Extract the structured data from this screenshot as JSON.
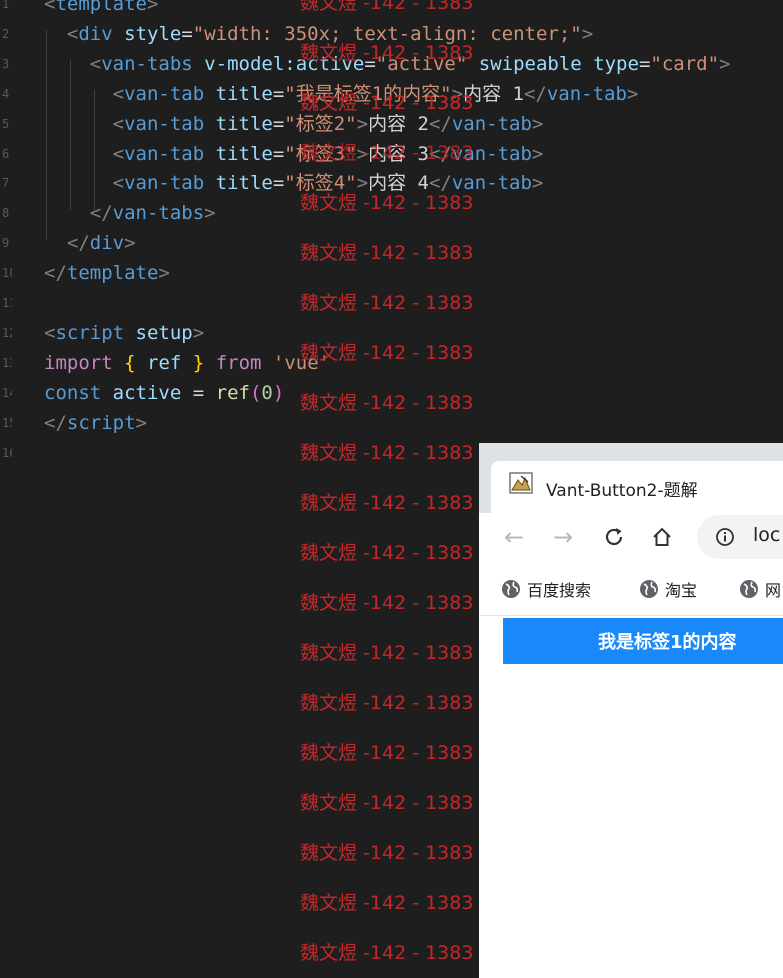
{
  "editor": {
    "line_numbers": [
      "1",
      "2",
      "3",
      "4",
      "5",
      "6",
      "7",
      "8",
      "9",
      "10",
      "11",
      "12",
      "13",
      "14",
      "15",
      "16"
    ],
    "lines": [
      [
        [
          "br",
          "<"
        ],
        [
          "tag",
          "template"
        ],
        [
          "br",
          ">"
        ]
      ],
      [
        [
          "txt",
          "  "
        ],
        [
          "br",
          "<"
        ],
        [
          "tag",
          "div"
        ],
        [
          "txt",
          " "
        ],
        [
          "attr",
          "style"
        ],
        [
          "txt",
          "="
        ],
        [
          "str",
          "\"width: 350x; text-align: center;\""
        ],
        [
          "br",
          ">"
        ]
      ],
      [
        [
          "txt",
          "    "
        ],
        [
          "br",
          "<"
        ],
        [
          "tag",
          "van-tabs"
        ],
        [
          "txt",
          " "
        ],
        [
          "attr",
          "v-model:active"
        ],
        [
          "txt",
          "="
        ],
        [
          "str",
          "\"active\""
        ],
        [
          "txt",
          " "
        ],
        [
          "attr",
          "swipeable"
        ],
        [
          "txt",
          " "
        ],
        [
          "attr",
          "type"
        ],
        [
          "txt",
          "="
        ],
        [
          "str",
          "\"card\""
        ],
        [
          "br",
          ">"
        ]
      ],
      [
        [
          "txt",
          "      "
        ],
        [
          "br",
          "<"
        ],
        [
          "tag",
          "van-tab"
        ],
        [
          "txt",
          " "
        ],
        [
          "attr",
          "title"
        ],
        [
          "txt",
          "="
        ],
        [
          "str",
          "\"我是标签1的内容\""
        ],
        [
          "br",
          ">"
        ],
        [
          "txt",
          "内容 1"
        ],
        [
          "br",
          "</"
        ],
        [
          "tag",
          "van-tab"
        ],
        [
          "br",
          ">"
        ]
      ],
      [
        [
          "txt",
          "      "
        ],
        [
          "br",
          "<"
        ],
        [
          "tag",
          "van-tab"
        ],
        [
          "txt",
          " "
        ],
        [
          "attr",
          "title"
        ],
        [
          "txt",
          "="
        ],
        [
          "str",
          "\"标签2\""
        ],
        [
          "br",
          ">"
        ],
        [
          "txt",
          "内容 2"
        ],
        [
          "br",
          "</"
        ],
        [
          "tag",
          "van-tab"
        ],
        [
          "br",
          ">"
        ]
      ],
      [
        [
          "txt",
          "      "
        ],
        [
          "br",
          "<"
        ],
        [
          "tag",
          "van-tab"
        ],
        [
          "txt",
          " "
        ],
        [
          "attr",
          "title"
        ],
        [
          "txt",
          "="
        ],
        [
          "str",
          "\"标签3\""
        ],
        [
          "br",
          ">"
        ],
        [
          "txt",
          "内容 3"
        ],
        [
          "br",
          "</"
        ],
        [
          "tag",
          "van-tab"
        ],
        [
          "br",
          ">"
        ]
      ],
      [
        [
          "txt",
          "      "
        ],
        [
          "br",
          "<"
        ],
        [
          "tag",
          "van-tab"
        ],
        [
          "txt",
          " "
        ],
        [
          "attr",
          "title"
        ],
        [
          "txt",
          "="
        ],
        [
          "str",
          "\"标签4\""
        ],
        [
          "br",
          ">"
        ],
        [
          "txt",
          "内容 4"
        ],
        [
          "br",
          "</"
        ],
        [
          "tag",
          "van-tab"
        ],
        [
          "br",
          ">"
        ]
      ],
      [
        [
          "txt",
          "    "
        ],
        [
          "br",
          "</"
        ],
        [
          "tag",
          "van-tabs"
        ],
        [
          "br",
          ">"
        ]
      ],
      [
        [
          "txt",
          "  "
        ],
        [
          "br",
          "</"
        ],
        [
          "tag",
          "div"
        ],
        [
          "br",
          ">"
        ]
      ],
      [
        [
          "br",
          "</"
        ],
        [
          "tag",
          "template"
        ],
        [
          "br",
          ">"
        ]
      ],
      [],
      [
        [
          "br",
          "<"
        ],
        [
          "tag",
          "script"
        ],
        [
          "txt",
          " "
        ],
        [
          "attr",
          "setup"
        ],
        [
          "br",
          ">"
        ]
      ],
      [
        [
          "kw",
          "import"
        ],
        [
          "txt",
          " "
        ],
        [
          "brace",
          "{"
        ],
        [
          "txt",
          " "
        ],
        [
          "var",
          "ref"
        ],
        [
          "txt",
          " "
        ],
        [
          "brace",
          "}"
        ],
        [
          "txt",
          " "
        ],
        [
          "kw",
          "from"
        ],
        [
          "txt",
          " "
        ],
        [
          "str",
          "'vue'"
        ]
      ],
      [
        [
          "kw2",
          "const"
        ],
        [
          "txt",
          " "
        ],
        [
          "var",
          "active"
        ],
        [
          "txt",
          " = "
        ],
        [
          "fn",
          "ref"
        ],
        [
          "paren",
          "("
        ],
        [
          "num",
          "0"
        ],
        [
          "paren",
          ")"
        ]
      ],
      [
        [
          "br",
          "</"
        ],
        [
          "tag",
          "script"
        ],
        [
          "br",
          ">"
        ]
      ],
      []
    ]
  },
  "watermark": {
    "text": "魏文煜 -142 - 1383"
  },
  "browser": {
    "tab_title": "Vant-Button2-题解",
    "url_text": "loc",
    "back_icon": "←",
    "forward_icon": "→",
    "reload_icon": "C",
    "home_icon": "⌂",
    "bookmarks": [
      {
        "label": "百度搜索"
      },
      {
        "label": "淘宝"
      },
      {
        "label": "网"
      }
    ],
    "active_tab_label": "我是标签1的内容",
    "accent_color": "#1989fa"
  }
}
